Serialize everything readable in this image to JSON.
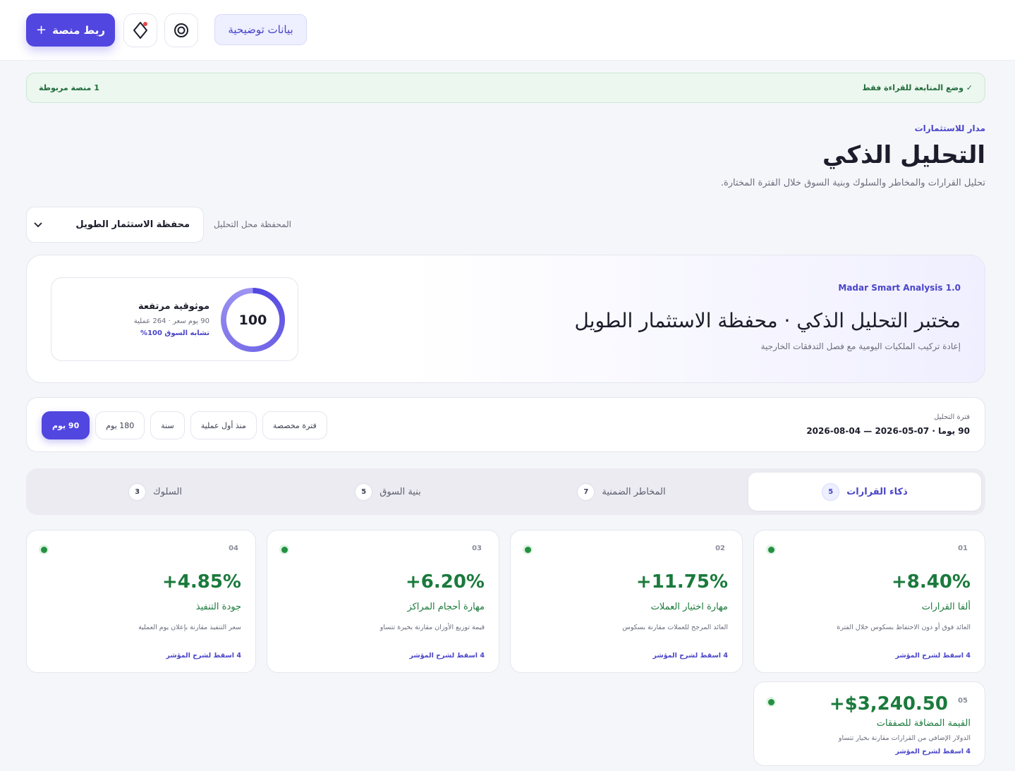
{
  "header": {
    "connect_button": "ربط منصة",
    "demo_button": "بيانات توضيحية",
    "icons": [
      "plus-icon",
      "diamond-icon",
      "target-icon"
    ]
  },
  "status": {
    "readonly": "✓ وضع المتابعة للقراءة فقط",
    "connected": "1 منصة مربوطة"
  },
  "page": {
    "eyebrow": "مدار للاستثمارات",
    "title": "التحليل الذكي",
    "subtitle": "تحليل القرارات والمخاطر والسلوك وبنية السوق خلال الفترة المختارة."
  },
  "portfolio": {
    "label": "المحفظة محل التحليل",
    "selected": "محفظة الاستثمار الطويل"
  },
  "hero": {
    "eyebrow": "Madar Smart Analysis 1.0",
    "title": "مختبر التحليل الذكي · محفظة الاستثمار الطويل",
    "subtitle": "إعادة تركيب الملكيات اليومية مع فصل التدفقات الخارجية",
    "score": "100",
    "score_title": "موثوقية مرتفعة",
    "score_meta": "90 يوم سعر · 264 عملية",
    "score_similarity": "تشابه السوق 100%",
    "score_fraction": 1.0
  },
  "period": {
    "label": "فترة التحليل",
    "range": "90 يوما · 07-05-2026 — 04-08-2026",
    "options": [
      "90 يوم",
      "180 يوم",
      "سنة",
      "منذ أول عملية",
      "فترة مخصصة"
    ],
    "active_index": 0
  },
  "tabs": [
    {
      "label": "ذكاء القرارات",
      "count": "5"
    },
    {
      "label": "المخاطر الضمنية",
      "count": "7"
    },
    {
      "label": "بنية السوق",
      "count": "5"
    },
    {
      "label": "السلوك",
      "count": "3"
    }
  ],
  "metrics": [
    {
      "num": "01",
      "value": "+8.40%",
      "title": "ألفا القرارات",
      "desc": "العائد فوق أو دون الاحتفاظ بسكوس خلال الفترة",
      "link": "4 اسقط لشرح المؤشر"
    },
    {
      "num": "02",
      "value": "+11.75%",
      "title": "مهارة اختيار العملات",
      "desc": "العائد المرجح للعملات مقارنة بسكوس",
      "link": "4 اسقط لشرح المؤشر"
    },
    {
      "num": "03",
      "value": "+6.20%",
      "title": "مهارة أحجام المراكز",
      "desc": "قيمة توزيع الأوزان مقارنة بخيرة تتساو",
      "link": "4 اسقط لشرح المؤشر"
    },
    {
      "num": "04",
      "value": "+4.85%",
      "title": "جودة التنفيذ",
      "desc": "سعر التنفيذ مقارنة بإعلان يوم العملية",
      "link": "4 اسقط لشرح المؤشر"
    },
    {
      "num": "05",
      "value": "+$3,240.50",
      "title": "القيمة المضافة للصفقات",
      "desc": "الدولار الإضافي من القرارات مقارنة بخيار تتساو",
      "link": "4 اسقط لشرح المؤشر"
    }
  ],
  "colors": {
    "accent": "#5146e0",
    "positive": "#1a7a3c",
    "status_bg": "#ecf7ef"
  }
}
